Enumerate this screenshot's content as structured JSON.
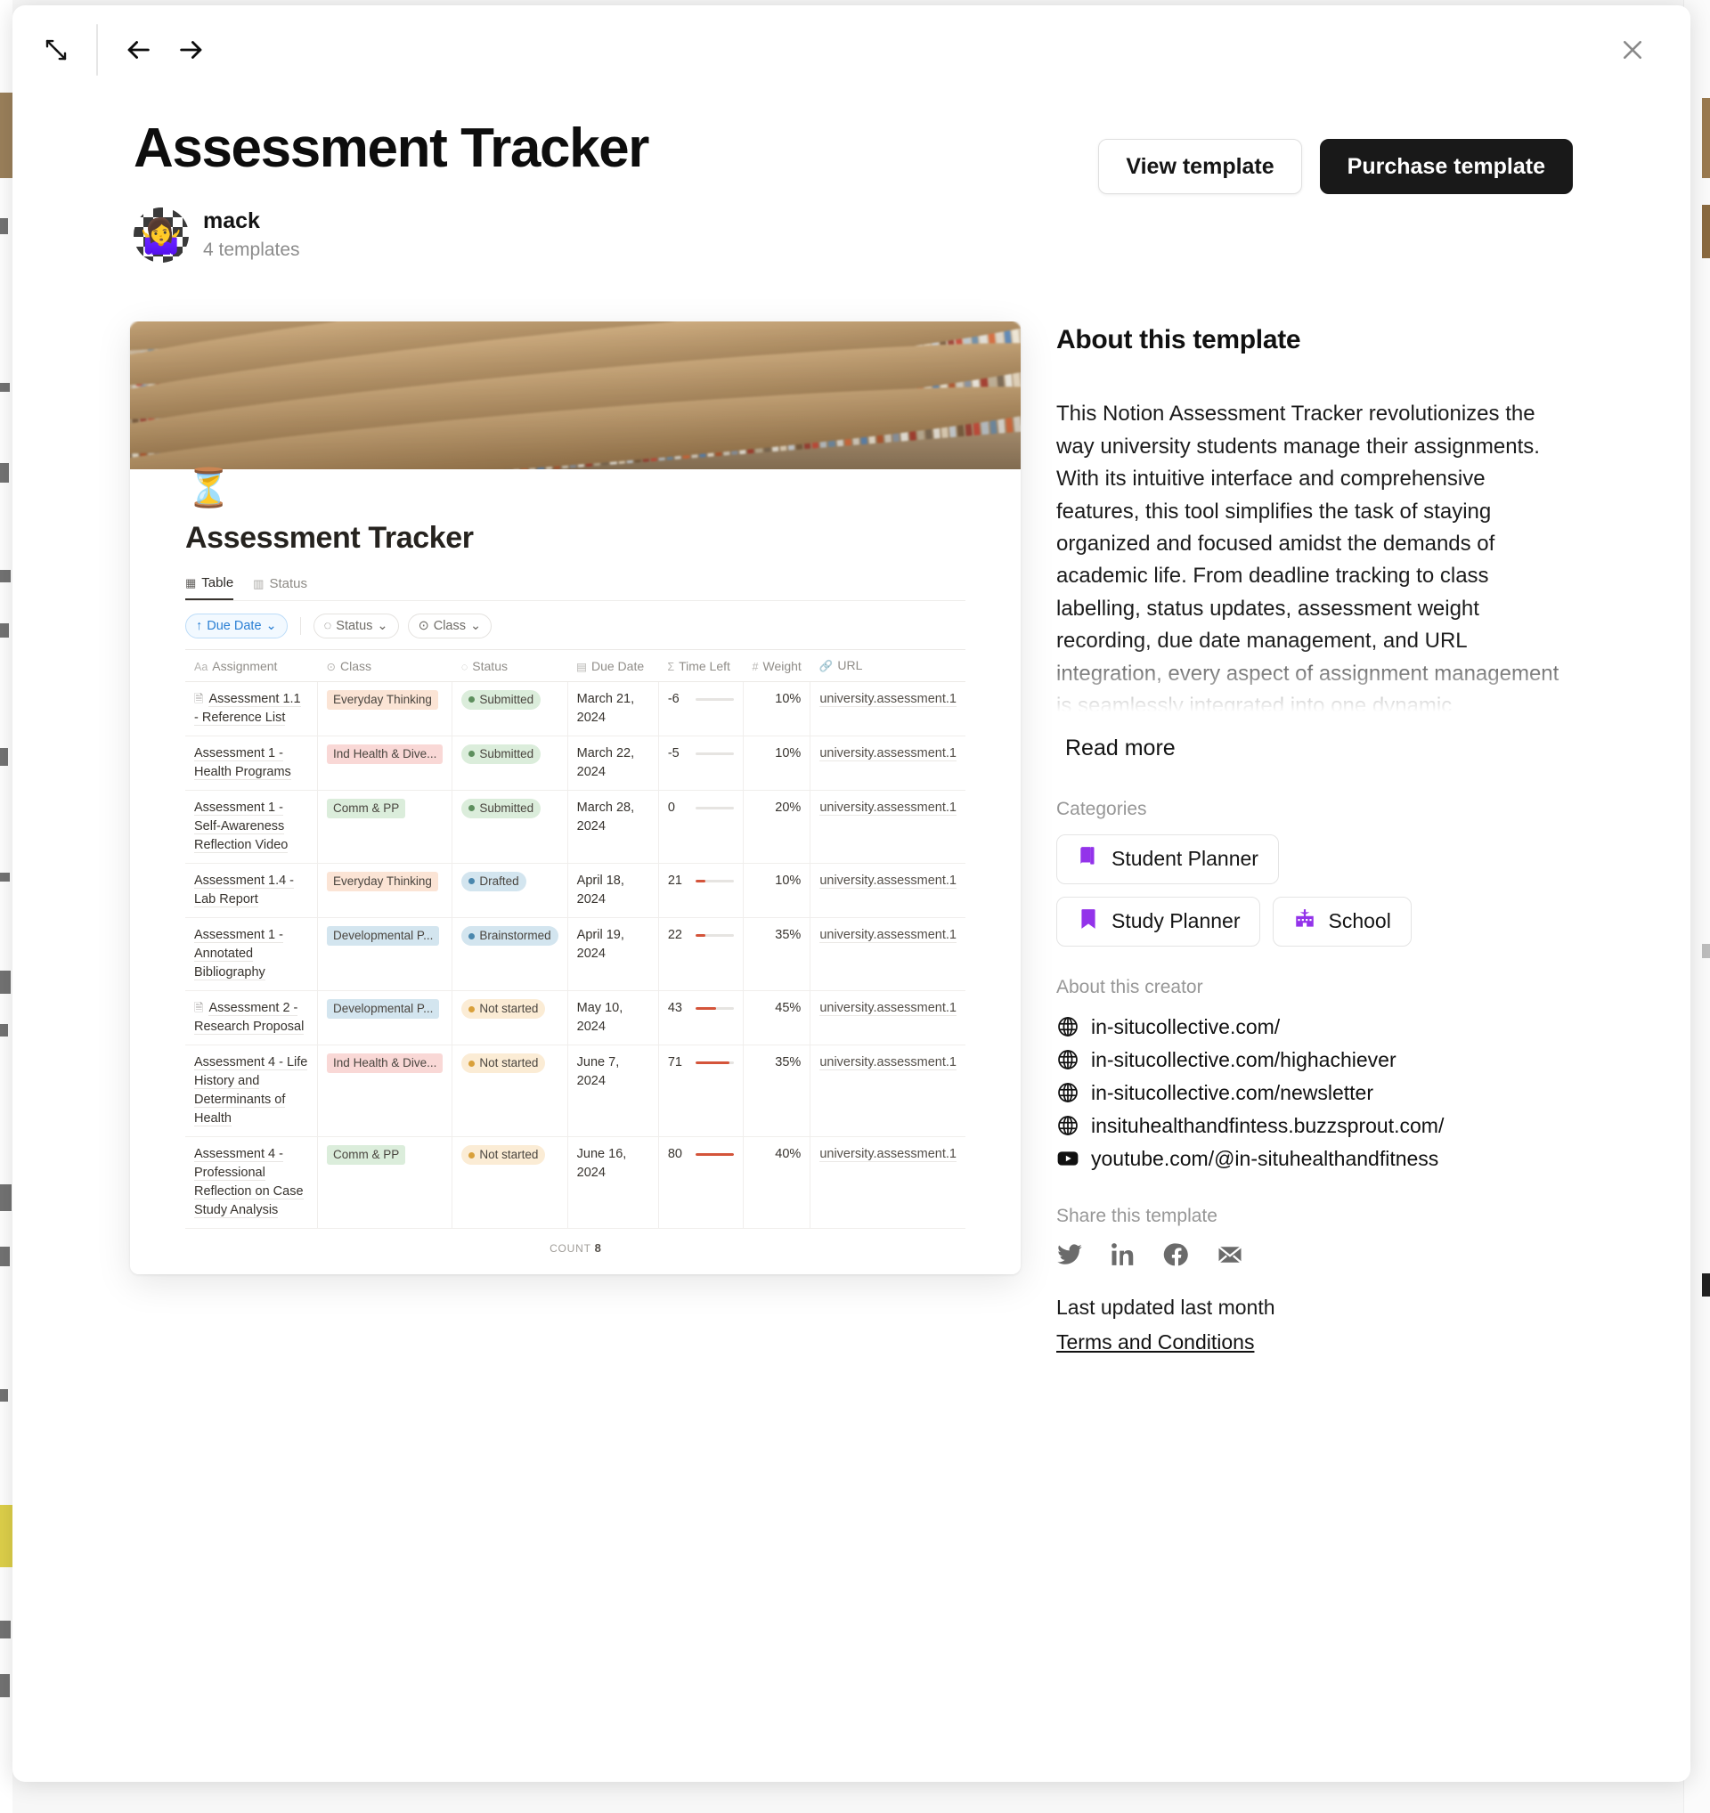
{
  "toolbar": {
    "expand_icon": "expand-arrows-icon",
    "back_icon": "arrow-left-icon",
    "forward_icon": "arrow-right-icon",
    "close_icon": "close-icon"
  },
  "header": {
    "title": "Assessment Tracker",
    "author_name": "mack",
    "author_templates": "4 templates",
    "view_template_label": "View template",
    "purchase_template_label": "Purchase template"
  },
  "preview": {
    "emoji": "⏳",
    "title": "Assessment Tracker",
    "tabs": [
      {
        "label": "Table",
        "icon": "table-icon",
        "active": true
      },
      {
        "label": "Status",
        "icon": "board-icon",
        "active": false
      }
    ],
    "filters": [
      {
        "label": "Due Date",
        "icon": "sort-up-icon",
        "kind": "sort"
      },
      {
        "label": "Status",
        "icon": "status-icon",
        "kind": "filter"
      },
      {
        "label": "Class",
        "icon": "select-icon",
        "kind": "filter"
      }
    ],
    "columns": [
      {
        "label": "Assignment",
        "icon": "text-icon"
      },
      {
        "label": "Class",
        "icon": "select-icon"
      },
      {
        "label": "Status",
        "icon": "status-icon"
      },
      {
        "label": "Due Date",
        "icon": "calendar-icon"
      },
      {
        "label": "Time Left",
        "icon": "formula-icon"
      },
      {
        "label": "Weight",
        "icon": "number-icon"
      },
      {
        "label": "URL",
        "icon": "link-icon"
      }
    ],
    "rows": [
      {
        "assignment": "Assessment 1.1 - Reference List",
        "has_doc_icon": true,
        "class": "Everyday Thinking",
        "class_color": "orange",
        "status": "Submitted",
        "status_key": "submitted",
        "due": "March 21, 2024",
        "time_left": "-6",
        "bar_pct": 0,
        "weight": "10%",
        "url": "university.assessment.1"
      },
      {
        "assignment": "Assessment 1 - Health Programs",
        "has_doc_icon": false,
        "class": "Ind Health & Dive...",
        "class_color": "red",
        "status": "Submitted",
        "status_key": "submitted",
        "due": "March 22, 2024",
        "time_left": "-5",
        "bar_pct": 0,
        "weight": "10%",
        "url": "university.assessment.1"
      },
      {
        "assignment": "Assessment 1 - Self-Awareness Reflection Video",
        "has_doc_icon": false,
        "class": "Comm & PP",
        "class_color": "green",
        "status": "Submitted",
        "status_key": "submitted",
        "due": "March 28, 2024",
        "time_left": "0",
        "bar_pct": 0,
        "weight": "20%",
        "url": "university.assessment.1"
      },
      {
        "assignment": "Assessment 1.4 - Lab Report",
        "has_doc_icon": false,
        "class": "Everyday Thinking",
        "class_color": "orange",
        "status": "Drafted",
        "status_key": "drafted",
        "due": "April 18, 2024",
        "time_left": "21",
        "bar_pct": 26,
        "weight": "10%",
        "url": "university.assessment.1"
      },
      {
        "assignment": "Assessment 1 - Annotated Bibliography",
        "has_doc_icon": false,
        "class": "Developmental P...",
        "class_color": "blue",
        "status": "Brainstormed",
        "status_key": "brainstormed",
        "due": "April 19, 2024",
        "time_left": "22",
        "bar_pct": 27,
        "weight": "35%",
        "url": "university.assessment.1"
      },
      {
        "assignment": "Assessment 2 - Research Proposal",
        "has_doc_icon": true,
        "class": "Developmental P...",
        "class_color": "blue",
        "status": "Not started",
        "status_key": "notstarted",
        "due": "May 10, 2024",
        "time_left": "43",
        "bar_pct": 54,
        "weight": "45%",
        "url": "university.assessment.1"
      },
      {
        "assignment": "Assessment 4 - Life History and Determinants of Health",
        "has_doc_icon": false,
        "class": "Ind Health & Dive...",
        "class_color": "red",
        "status": "Not started",
        "status_key": "notstarted",
        "due": "June 7, 2024",
        "time_left": "71",
        "bar_pct": 89,
        "weight": "35%",
        "url": "university.assessment.1"
      },
      {
        "assignment": "Assessment 4 - Professional Reflection on Case Study Analysis",
        "has_doc_icon": false,
        "class": "Comm & PP",
        "class_color": "green",
        "status": "Not started",
        "status_key": "notstarted",
        "due": "June 16, 2024",
        "time_left": "80",
        "bar_pct": 100,
        "weight": "40%",
        "url": "university.assessment.1"
      }
    ],
    "count_label": "COUNT",
    "count_value": "8"
  },
  "about": {
    "heading": "About this template",
    "body": "This Notion Assessment Tracker revolutionizes the way university students manage their assignments. With its intuitive interface and comprehensive features, this tool simplifies the task of staying organized and focused amidst the demands of academic life. From deadline tracking to class labelling, status updates, assessment weight recording, due date management, and URL integration, every aspect of assignment management is seamlessly integrated into one dynamic",
    "read_more_label": "Read more"
  },
  "categories": {
    "label": "Categories",
    "items": [
      {
        "label": "Student Planner",
        "icon": "student-planner-icon"
      },
      {
        "label": "Study Planner",
        "icon": "bookmark-icon"
      },
      {
        "label": "School",
        "icon": "school-icon"
      }
    ],
    "icon_color": "#9333ea"
  },
  "creator": {
    "label": "About this creator",
    "links": [
      {
        "text": "in-situcollective.com/",
        "icon": "globe-icon"
      },
      {
        "text": "in-situcollective.com/highachiever",
        "icon": "globe-icon"
      },
      {
        "text": "in-situcollective.com/newsletter",
        "icon": "globe-icon"
      },
      {
        "text": "insituhealthandfintess.buzzsprout.com/",
        "icon": "globe-icon"
      },
      {
        "text": "youtube.com/@in-situhealthandfitness",
        "icon": "youtube-icon"
      }
    ]
  },
  "share": {
    "label": "Share this template",
    "icons": [
      {
        "name": "twitter-icon"
      },
      {
        "name": "linkedin-icon"
      },
      {
        "name": "facebook-icon"
      },
      {
        "name": "email-icon"
      }
    ],
    "updated_text": "Last updated last month",
    "terms_label": "Terms and Conditions"
  }
}
